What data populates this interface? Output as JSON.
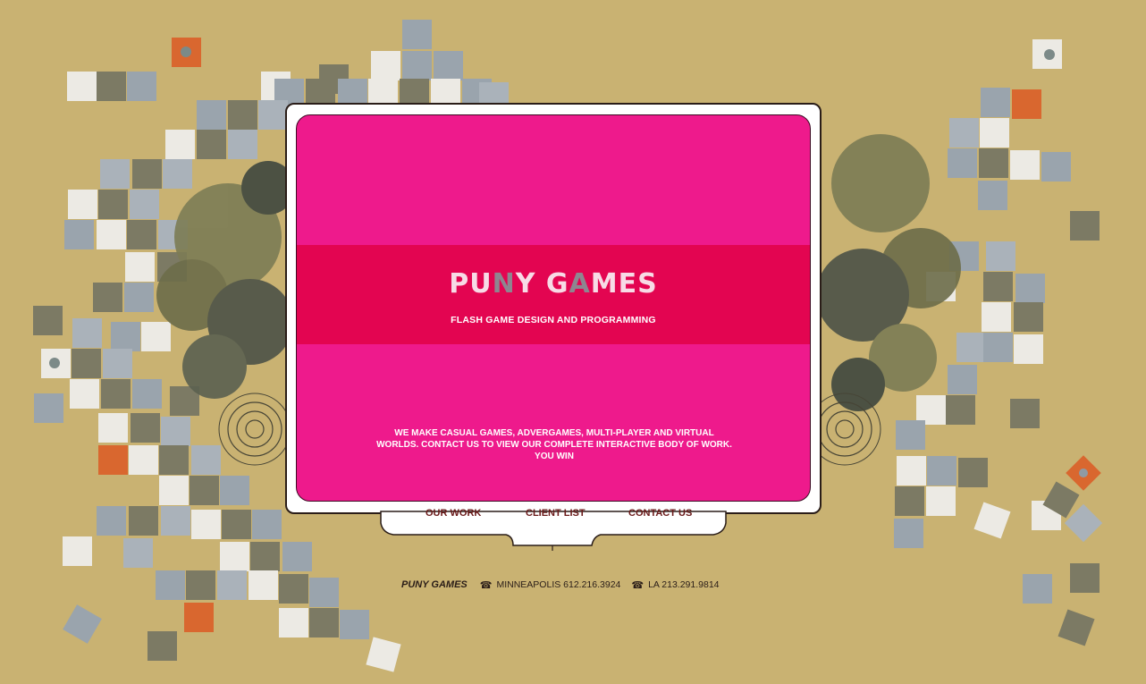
{
  "logo": {
    "part1": "PU",
    "part2": "N",
    "part3": "Y G",
    "part4": "A",
    "part5": "MES"
  },
  "tagline": "FLASH GAME DESIGN AND PROGRAMMING",
  "description": {
    "line1": "WE MAKE CASUAL GAMES, ADVERGAMES, MULTI-PLAYER AND VIRTUAL",
    "line2": "WORLDS.  CONTACT US TO VIEW OUR COMPLETE INTERACTIVE BODY OF WORK.",
    "line3": "YOU WIN"
  },
  "nav": {
    "our_work": "OUR WORK",
    "client_list": "CLIENT LIST",
    "contact_us": "CONTACT US"
  },
  "footer": {
    "brand": "PUNY GAMES",
    "phone_icon": "☎",
    "minneapolis": "MINNEAPOLIS 612.216.3924",
    "la": "LA 213.291.9814"
  },
  "colors": {
    "background": "#c9b272",
    "screen_pink": "#ee1a8c",
    "band_red": "#e30551",
    "nav_text": "#6a1a1a"
  }
}
